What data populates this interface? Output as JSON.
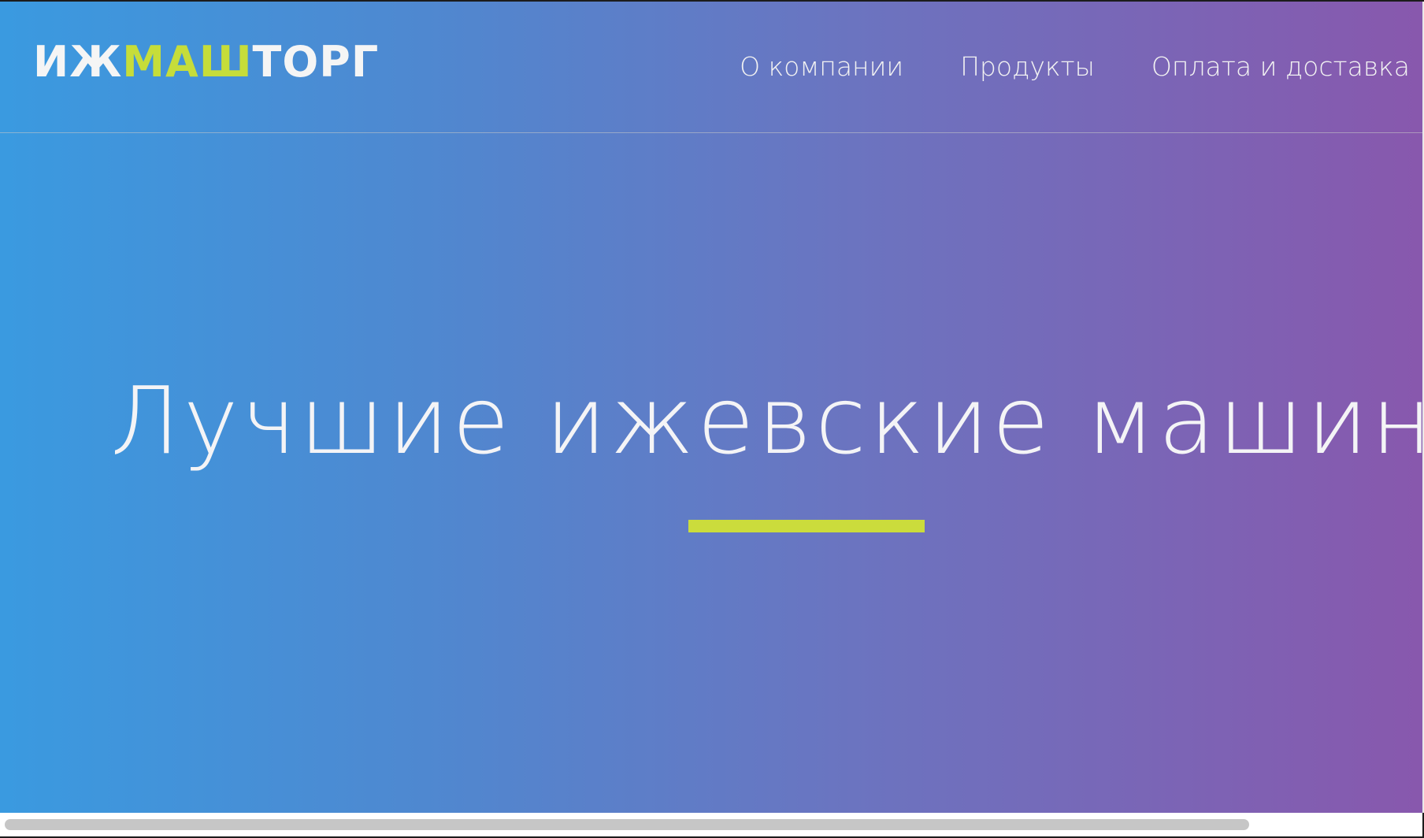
{
  "header": {
    "logo": {
      "part1": "ИЖ",
      "part2": "МАШ",
      "part3": "ТОРГ"
    },
    "nav": [
      {
        "label": "О компании"
      },
      {
        "label": "Продукты"
      },
      {
        "label": "Оплата и доставка"
      }
    ]
  },
  "hero": {
    "title": "Лучшие ижевские машины"
  },
  "colors": {
    "gradient_start": "#3a9ae0",
    "gradient_end": "#8858ad",
    "accent": "#cbdc3c",
    "text": "#f4f4f6"
  }
}
